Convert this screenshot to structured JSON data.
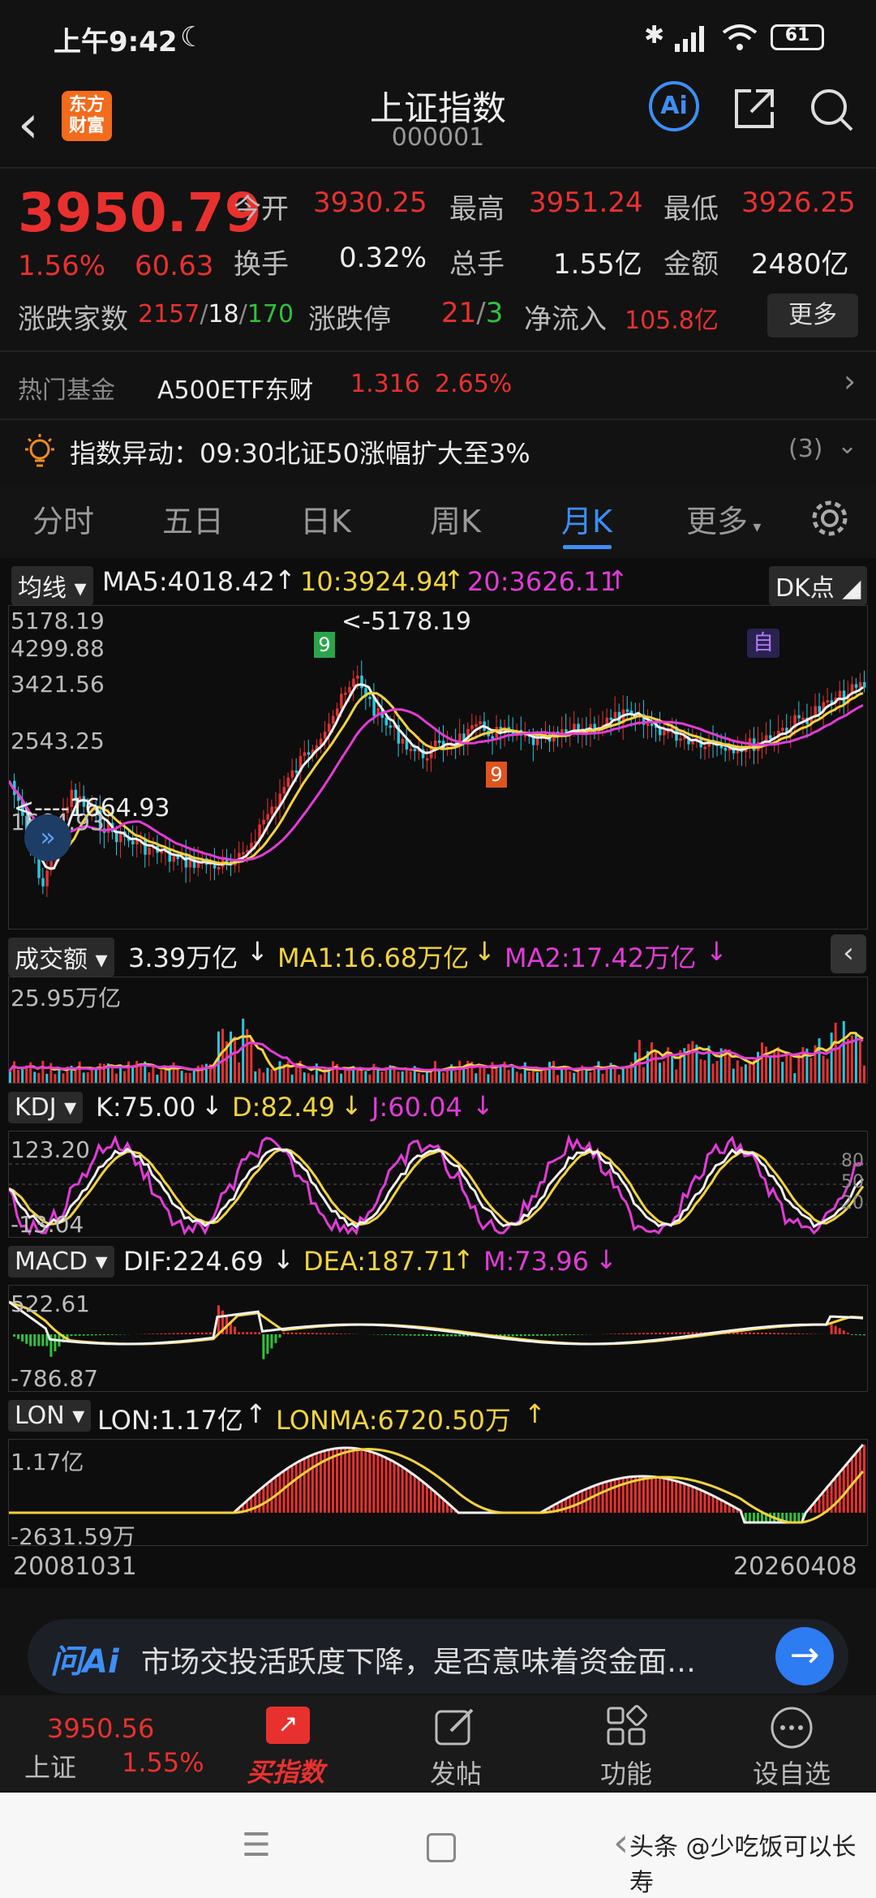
{
  "status": {
    "time": "上午9:42",
    "battery": "61"
  },
  "header": {
    "title": "上证指数",
    "code": "000001",
    "logo_line1": "东方",
    "logo_line2": "财富",
    "ai_label": "Ai"
  },
  "quote": {
    "price": "3950.79",
    "pct": "1.56%",
    "chg": "60.63",
    "open_label": "今开",
    "open": "3930.25",
    "high_label": "最高",
    "high": "3951.24",
    "low_label": "最低",
    "low": "3926.25",
    "turnover_label": "换手",
    "turnover": "0.32%",
    "volume_label": "总手",
    "volume": "1.55亿",
    "amount_label": "金额",
    "amount": "2480亿",
    "updown_label": "涨跌家数",
    "up": "2157",
    "flat": "18",
    "down": "170",
    "limit_label": "涨跌停",
    "limit_up": "21",
    "limit_down": "3",
    "netin_label": "净流入",
    "netin": "105.8亿",
    "more_label": "更多"
  },
  "fund": {
    "label": "热门基金",
    "name": "A500ETF东财",
    "price": "1.316",
    "pct": "2.65%"
  },
  "alert": {
    "text": "指数异动：09:30北证50涨幅扩大至3%",
    "count": "(3)"
  },
  "tabs": [
    "分时",
    "五日",
    "日K",
    "周K",
    "月K",
    "更多"
  ],
  "main_chart": {
    "selector": "均线",
    "ma5": "MA5:4018.42",
    "ma10": "10:3924.94",
    "ma20": "20:3626.11",
    "dk": "DK点",
    "y_labels": [
      "5178.19",
      "4299.88",
      "3421.56",
      "2543.25",
      "1664.93"
    ],
    "high_mark": "<-5178.19",
    "low_mark": "<----1664.93",
    "signal_top": "9",
    "signal_bottom": "9",
    "self_mark": "自"
  },
  "volume_chart": {
    "selector": "成交额",
    "value": "3.39万亿",
    "ma1": "MA1:16.68万亿",
    "ma2": "MA2:17.42万亿",
    "y_top": "25.95万亿"
  },
  "kdj_chart": {
    "selector": "KDJ",
    "k": "K:75.00",
    "d": "D:82.49",
    "j": "J:60.04",
    "y_top": "123.20",
    "y_bottom": "-13.04",
    "r80": "80",
    "r50": "50",
    "r20": "20"
  },
  "macd_chart": {
    "selector": "MACD",
    "dif": "DIF:224.69",
    "dea": "DEA:187.71",
    "m": "M:73.96",
    "y_top": "522.61",
    "y_bottom": "-786.87"
  },
  "lon_chart": {
    "selector": "LON",
    "lon": "LON:1.17亿",
    "lonma": "LONMA:6720.50万",
    "y_top": "1.17亿",
    "y_bottom": "-2631.59万"
  },
  "x_axis": {
    "start": "20081031",
    "end": "20260408"
  },
  "ai_bar": {
    "brand": "问Ai",
    "question": "市场交投活跃度下降，是否意味着资金面…"
  },
  "bottom_nav": {
    "index_price": "3950.56",
    "index_name": "上证",
    "index_pct": "1.55%",
    "buy": "买指数",
    "post": "发帖",
    "func": "功能",
    "watch": "设自选"
  },
  "watermark": "头条 @少吃饭可以长寿",
  "colors": {
    "up": "#e8312f",
    "down": "#2fc23c",
    "accent": "#3d8ef6",
    "ma10": "#f3d33d",
    "ma20": "#e23bd8"
  }
}
